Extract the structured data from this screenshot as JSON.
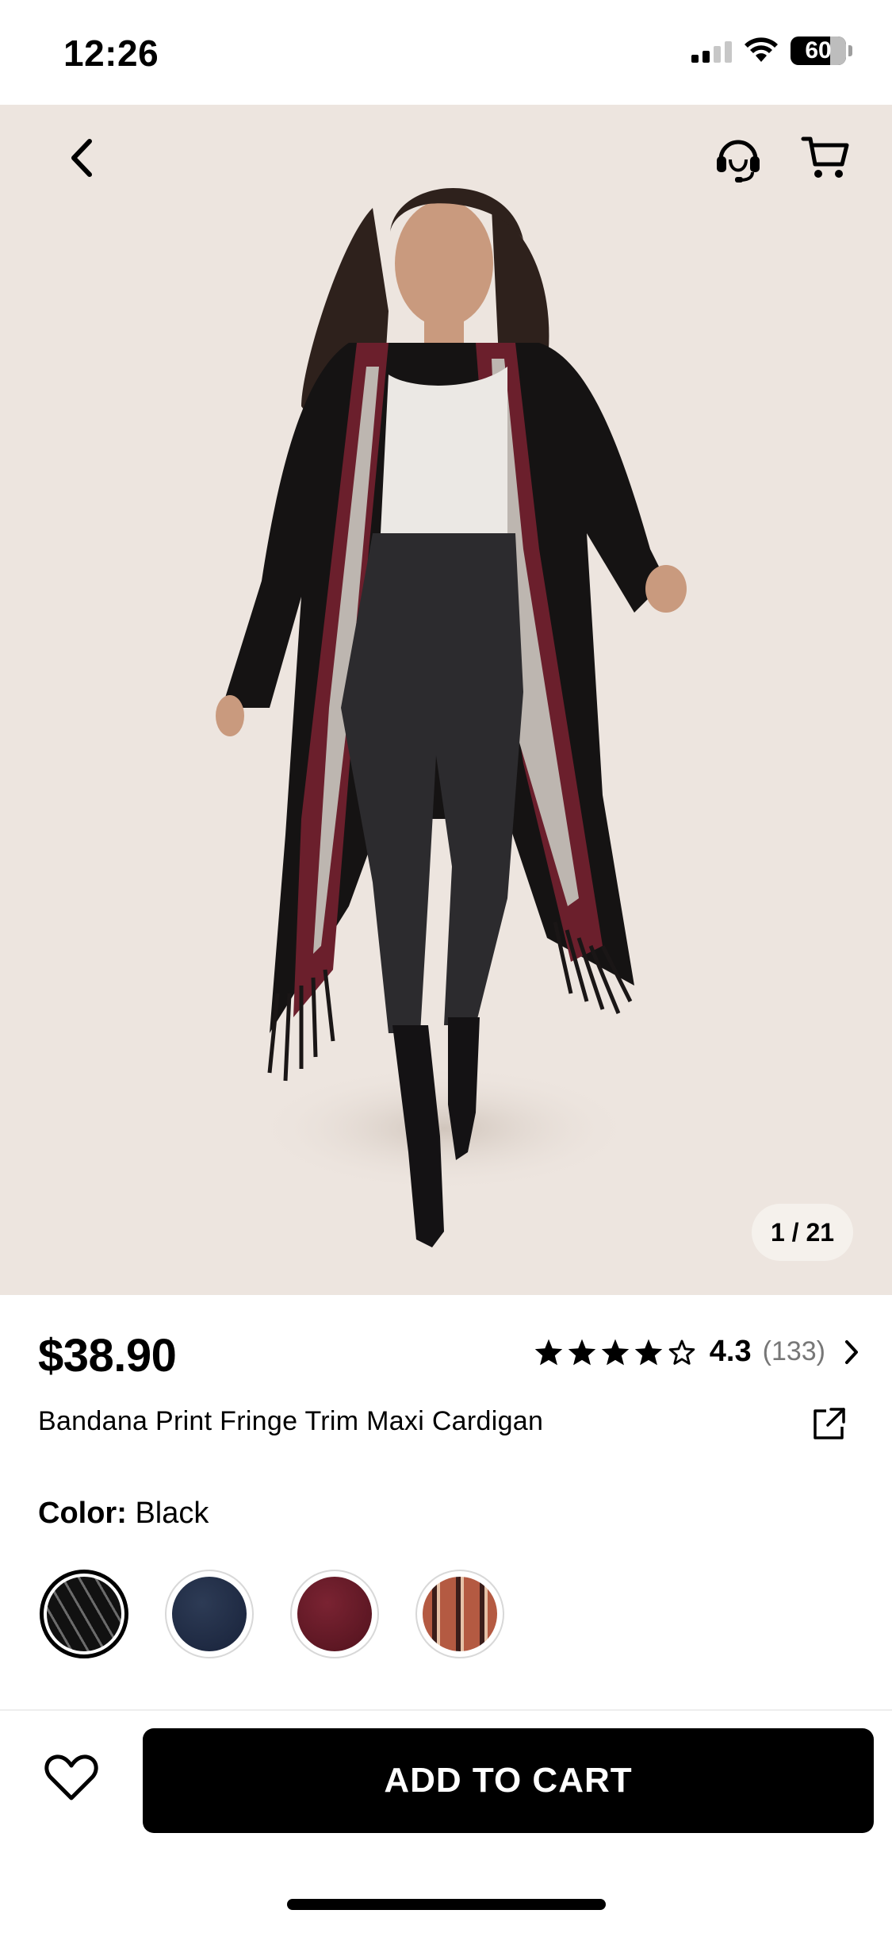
{
  "status_bar": {
    "time": "12:26",
    "battery": "60"
  },
  "hero": {
    "counter": "1 / 21",
    "icons": {
      "back": "chevron-left-icon",
      "support": "headset-icon",
      "cart": "cart-icon"
    }
  },
  "product": {
    "price": "$38.90",
    "rating_value": "4.3",
    "rating_count": "(133)",
    "stars": 4.3,
    "title": "Bandana Print Fringe Trim Maxi Cardigan",
    "color_label": "Color:",
    "color_value": "Black",
    "swatches": [
      "black",
      "navy",
      "burgundy",
      "rust-pattern"
    ]
  },
  "actions": {
    "add_to_cart": "ADD TO CART"
  },
  "colors": {
    "hero_bg": "#ede5df",
    "accent": "#000000"
  }
}
